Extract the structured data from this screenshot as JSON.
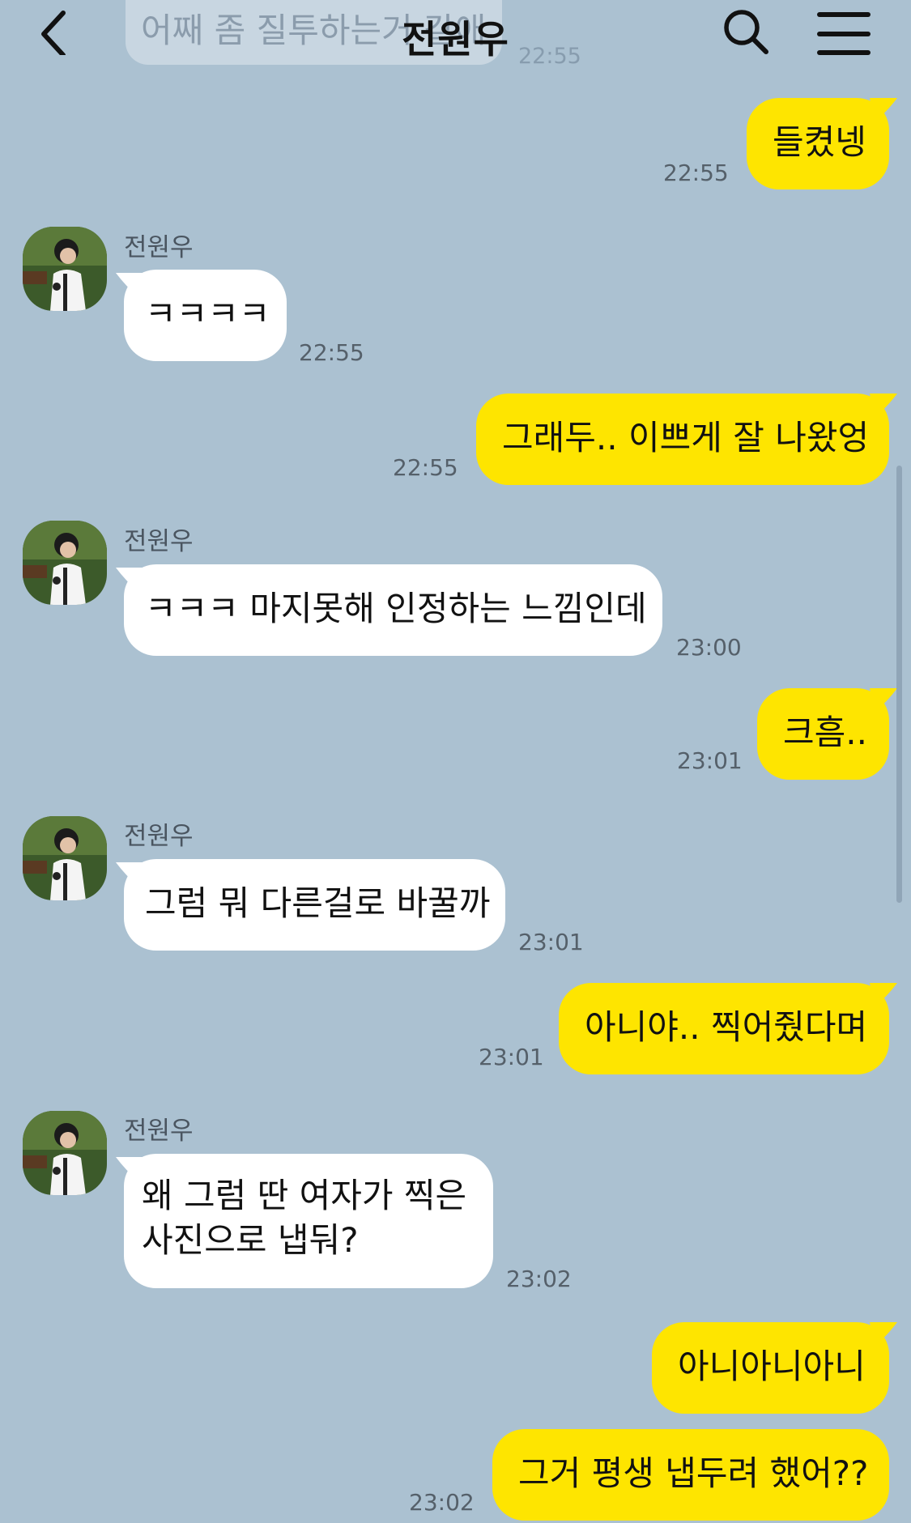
{
  "header": {
    "title": "전원우"
  },
  "ghost": {
    "text": "어째 좀 질투하는거 같애",
    "time": "22:55"
  },
  "messages": [
    {
      "from": "me",
      "text": "들켰넹",
      "time": "22:55"
    },
    {
      "from": "other",
      "sender": "전원우",
      "text": "ㅋㅋㅋㅋ",
      "time": "22:55"
    },
    {
      "from": "me",
      "text": "그래두.. 이쁘게 잘 나왔엉",
      "time": "22:55"
    },
    {
      "from": "other",
      "sender": "전원우",
      "text": "ㅋㅋㅋ 마지못해 인정하는 느낌인데",
      "time": "23:00"
    },
    {
      "from": "me",
      "text": "크흠..",
      "time": "23:01"
    },
    {
      "from": "other",
      "sender": "전원우",
      "text": "그럼 뭐 다른걸로 바꿀까",
      "time": "23:01"
    },
    {
      "from": "me",
      "text": "아니야.. 찍어줬다며",
      "time": "23:01"
    },
    {
      "from": "other",
      "sender": "전원우",
      "text": "왜 그럼 딴 여자가 찍은 사진으로 냅둬?",
      "time": "23:02"
    },
    {
      "from": "me",
      "text": "아니아니아니",
      "time": ""
    },
    {
      "from": "me",
      "text": "그거 평생 냅두려 했어??",
      "time": "23:02"
    }
  ],
  "colors": {
    "background": "#abc1d1",
    "my_bubble": "#fee500",
    "other_bubble": "#ffffff"
  },
  "icons": [
    "back-arrow-icon",
    "search-icon",
    "menu-icon",
    "profile-avatar"
  ]
}
